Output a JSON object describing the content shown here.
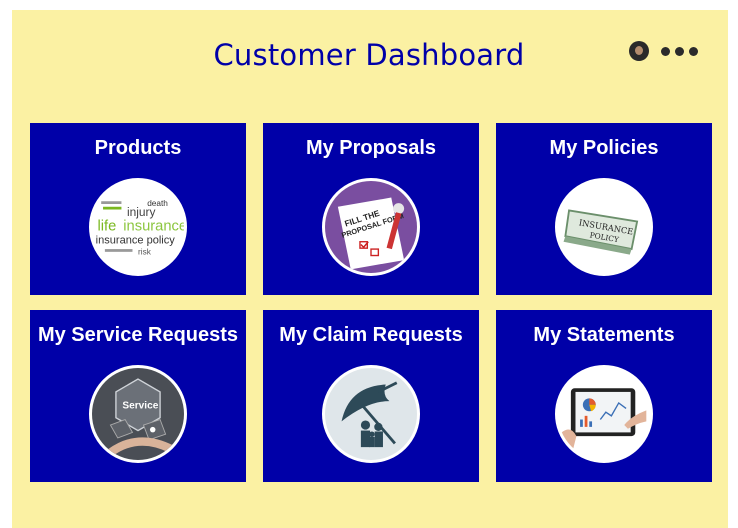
{
  "header": {
    "title": "Customer Dashboard"
  },
  "tiles": [
    {
      "label": "Products",
      "icon": "insurance-wordcloud-icon"
    },
    {
      "label": "My Proposals",
      "icon": "proposal-form-icon"
    },
    {
      "label": "My Policies",
      "icon": "insurance-policy-icon"
    },
    {
      "label": "My Service Requests",
      "icon": "service-icon"
    },
    {
      "label": "My Claim Requests",
      "icon": "umbrella-family-icon"
    },
    {
      "label": "My Statements",
      "icon": "tablet-charts-icon"
    }
  ],
  "images": {
    "wordcloud_words": [
      "death",
      "injury",
      "life",
      "insurance",
      "insurance policy",
      "risk"
    ],
    "proposal_text": "FILL THE PROPOSAL FORM",
    "policy_text": "INSURANCE POLICY",
    "service_text": "Service"
  },
  "colors": {
    "background": "#fbf1a3",
    "tile": "#0000a8",
    "title": "#0000a8"
  }
}
